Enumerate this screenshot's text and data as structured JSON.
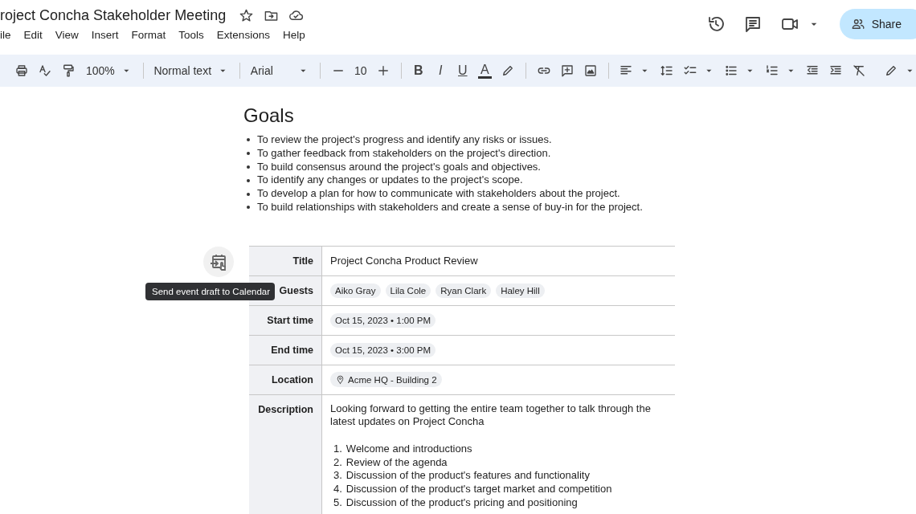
{
  "header": {
    "title": "roject Concha Stakeholder Meeting",
    "menu": [
      "ile",
      "Edit",
      "View",
      "Insert",
      "Format",
      "Tools",
      "Extensions",
      "Help"
    ],
    "share": "Share"
  },
  "toolbar": {
    "zoom": "100%",
    "style": "Normal text",
    "font": "Arial",
    "size": "10",
    "bold": "B",
    "italic": "I",
    "underline": "U",
    "text_color": "A"
  },
  "heading": "Goals",
  "goals": [
    "To review the project's progress and identify any risks or issues.",
    "To gather feedback from stakeholders on the project's direction.",
    "To build consensus around the project's goals and objectives.",
    "To identify any changes or updates to the project's scope.",
    "To develop a plan for how to communicate with stakeholders about the project.",
    "To build relationships with stakeholders and create a sense of buy-in for the project."
  ],
  "tooltip": "Send event draft to Calendar",
  "event": [
    {
      "label": "Title",
      "kind": "text",
      "value": "Project Concha Product Review"
    },
    {
      "label": "Guests",
      "kind": "chips",
      "chips": [
        "Aiko Gray",
        "Lila Cole",
        "Ryan Clark",
        "Haley Hill"
      ]
    },
    {
      "label": "Start time",
      "kind": "chips",
      "chips": [
        "Oct 15, 2023 • 1:00 PM"
      ]
    },
    {
      "label": "End time",
      "kind": "chips",
      "chips": [
        "Oct 15, 2023 • 3:00 PM"
      ]
    },
    {
      "label": "Location",
      "kind": "location",
      "chips": [
        "Acme HQ - Building 2"
      ]
    },
    {
      "label": "Description",
      "kind": "description",
      "value": "Looking forward to getting the entire team together to talk through the latest updates on Project Concha",
      "items": [
        {
          "number": "1.",
          "text": "Welcome and introductions"
        },
        {
          "number": "2.",
          "text": "Review of the agenda"
        },
        {
          "number": "3.",
          "text": "Discussion of the product's features and functionality"
        },
        {
          "number": "4.",
          "text": "Discussion of the product's target market and competition"
        },
        {
          "number": "5.",
          "text": "Discussion of the product's pricing and positioning"
        }
      ]
    }
  ]
}
